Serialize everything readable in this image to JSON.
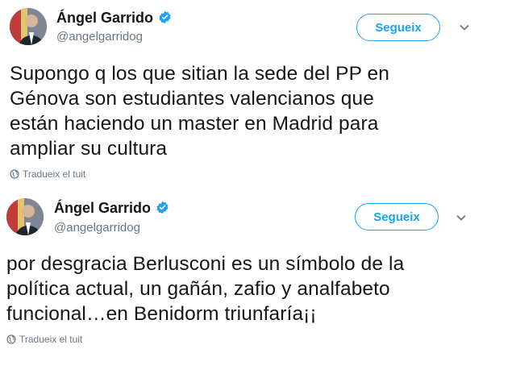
{
  "tweets": [
    {
      "author": {
        "name": "Ángel Garrido",
        "handle": "@angelgarridog",
        "verified": true
      },
      "follow_label": "Segueix",
      "lines": [
        "Supongo q los que sitian la sede del PP en",
        "Génova son estudiantes valencianos que",
        "están haciendo un master en Madrid para",
        "ampliar su cultura"
      ],
      "translate_label": "Tradueix el tuit"
    },
    {
      "author": {
        "name": "Ángel Garrido",
        "handle": "@angelgarridog",
        "verified": true
      },
      "follow_label": "Segueix",
      "lines": [
        "por desgracia Berlusconi es un símbolo de la",
        "política actual, un gañán, zafio y analfabeto",
        "funcional…en Benidorm  triunfaría¡¡"
      ],
      "translate_label": "Tradueix el tuit"
    }
  ],
  "colors": {
    "accent": "#1da1f2",
    "secondary_text": "#657786",
    "primary_text": "#14171a"
  },
  "icons": {
    "verified": "verified-badge-icon",
    "chevron": "chevron-down-icon",
    "translate": "globe-icon"
  }
}
